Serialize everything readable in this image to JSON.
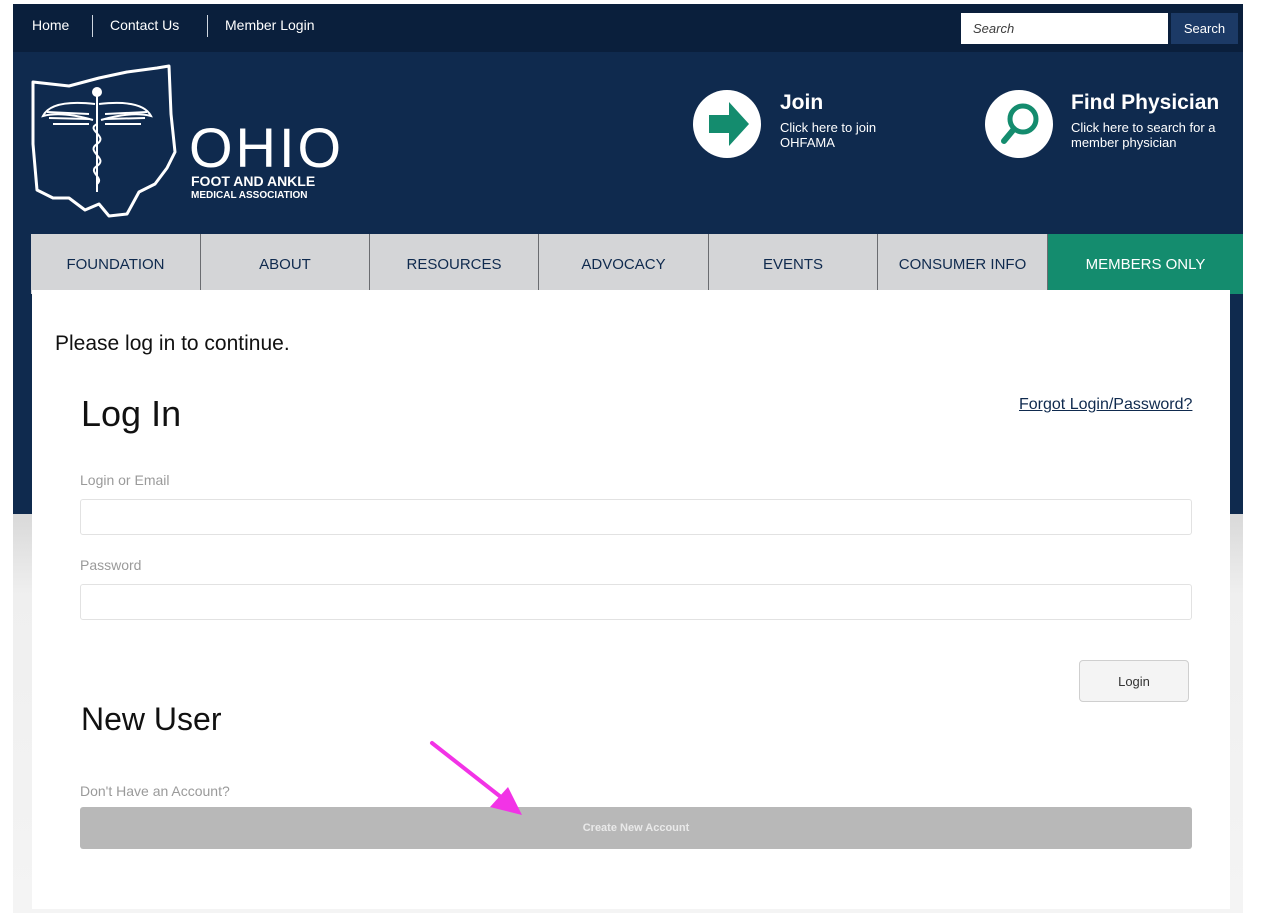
{
  "topbar": {
    "links": [
      "Home",
      "Contact Us",
      "Member Login"
    ],
    "search_placeholder": "Search",
    "search_button": "Search"
  },
  "logo": {
    "word": "OHIO",
    "sub1": "FOOT AND ANKLE",
    "sub2": "MEDICAL ASSOCIATION"
  },
  "promos": {
    "join": {
      "title": "Join",
      "text": "Click here to join OHFAMA",
      "icon": "arrow-right-icon"
    },
    "find": {
      "title": "Find Physician",
      "text": "Click here to search for a member physician",
      "icon": "search-icon"
    }
  },
  "nav": {
    "items": [
      "FOUNDATION",
      "ABOUT",
      "RESOURCES",
      "ADVOCACY",
      "EVENTS",
      "CONSUMER INFO",
      "MEMBERS ONLY"
    ],
    "active": "MEMBERS ONLY"
  },
  "login": {
    "intro": "Please log in to continue.",
    "heading": "Log In",
    "forgot": "Forgot Login/Password?",
    "login_label": "Login or Email",
    "password_label": "Password",
    "button": "Login"
  },
  "new_user": {
    "heading": "New User",
    "prompt": "Don't Have an Account?",
    "button": "Create New Account"
  },
  "colors": {
    "header_navy": "#0f2a4e",
    "accent_green": "#148c6e",
    "annotation_arrow": "#f233e6"
  }
}
